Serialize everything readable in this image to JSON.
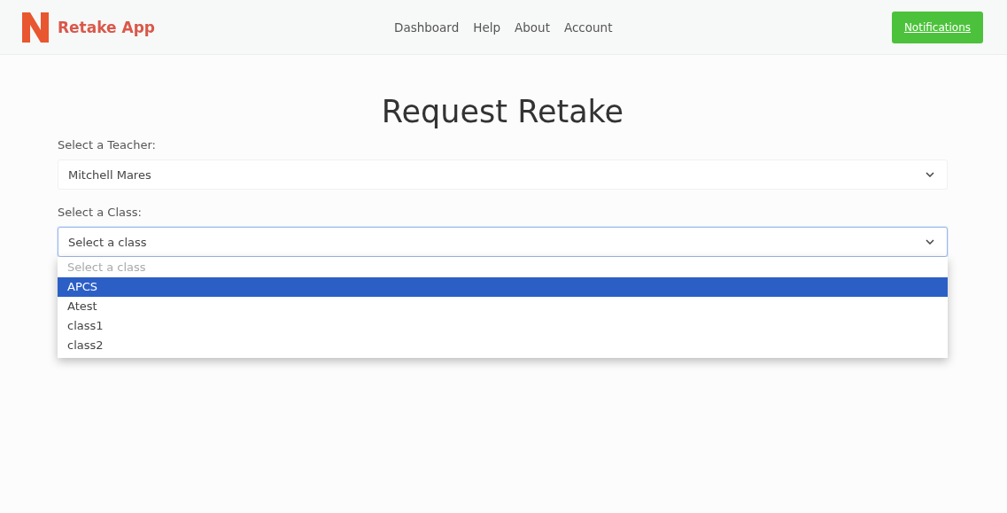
{
  "brand": {
    "name": "Retake App"
  },
  "nav": [
    {
      "label": "Dashboard"
    },
    {
      "label": "Help"
    },
    {
      "label": "About"
    },
    {
      "label": "Account"
    }
  ],
  "notifications_button": {
    "label": "Notifications"
  },
  "title": "Request Retake",
  "teacher": {
    "label": "Select a Teacher:",
    "value": "Mitchell Mares",
    "focused": false
  },
  "class": {
    "label": "Select a Class:",
    "value": "Select a class",
    "focused": true,
    "options": [
      {
        "label": "Select a class",
        "highlighted": false,
        "disabled": true
      },
      {
        "label": "APCS",
        "highlighted": true,
        "disabled": false
      },
      {
        "label": "Atest",
        "highlighted": false,
        "disabled": false
      },
      {
        "label": "class1",
        "highlighted": false,
        "disabled": false
      },
      {
        "label": "class2",
        "highlighted": false,
        "disabled": false
      }
    ]
  }
}
